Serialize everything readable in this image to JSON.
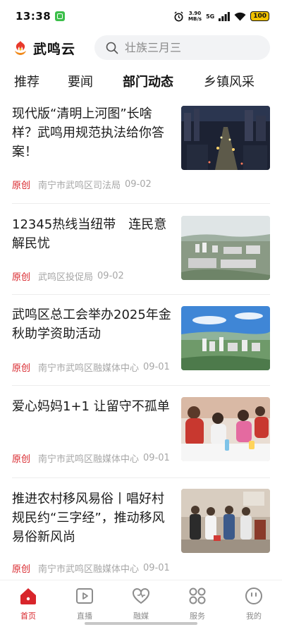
{
  "status_bar": {
    "time": "13:38",
    "net_speed_value": "3.90",
    "net_speed_unit": "MB/s",
    "signal_label": "5G",
    "battery": "100"
  },
  "header": {
    "brand": "武鸣云",
    "search_placeholder": "壮族三月三"
  },
  "tabs": [
    {
      "label": "推荐"
    },
    {
      "label": "要闻"
    },
    {
      "label": "部门动态",
      "active": true
    },
    {
      "label": "乡镇风采"
    }
  ],
  "articles": [
    {
      "title": "现代版“清明上河图”长啥样？武鸣用规范执法给你答案！",
      "tag": "原创",
      "source": "南宁市武鸣区司法局",
      "date": "09-02",
      "image": "night-city-street"
    },
    {
      "title": "12345热线当纽带　连民意解民忧",
      "tag": "原创",
      "source": "武鸣区投促局",
      "date": "09-02",
      "image": "aerial-town"
    },
    {
      "title": "武鸣区总工会举办2025年金秋助学资助活动",
      "tag": "原创",
      "source": "南宁市武鸣区融媒体中心",
      "date": "09-01",
      "image": "aerial-city-blue-sky"
    },
    {
      "title": "爱心妈妈1+1 让留守不孤单",
      "tag": "原创",
      "source": "南宁市武鸣区融媒体中心",
      "date": "09-01",
      "image": "children-activity"
    },
    {
      "title": "推进农村移风易俗丨唱好村规民约“三字经”，推动移风易俗新风尚",
      "tag": "原创",
      "source": "南宁市武鸣区融媒体中心",
      "date": "09-01",
      "image": "village-meeting"
    }
  ],
  "bottom_nav": [
    {
      "label": "首页",
      "icon": "home-icon",
      "active": true
    },
    {
      "label": "直播",
      "icon": "live-play-icon"
    },
    {
      "label": "融媒",
      "icon": "heart-media-icon"
    },
    {
      "label": "服务",
      "icon": "service-grid-icon"
    },
    {
      "label": "我的",
      "icon": "profile-icon"
    }
  ],
  "colors": {
    "accent": "#d8252b",
    "search_bg": "#f2f3f5",
    "meta_gray": "#a7a7a7"
  }
}
